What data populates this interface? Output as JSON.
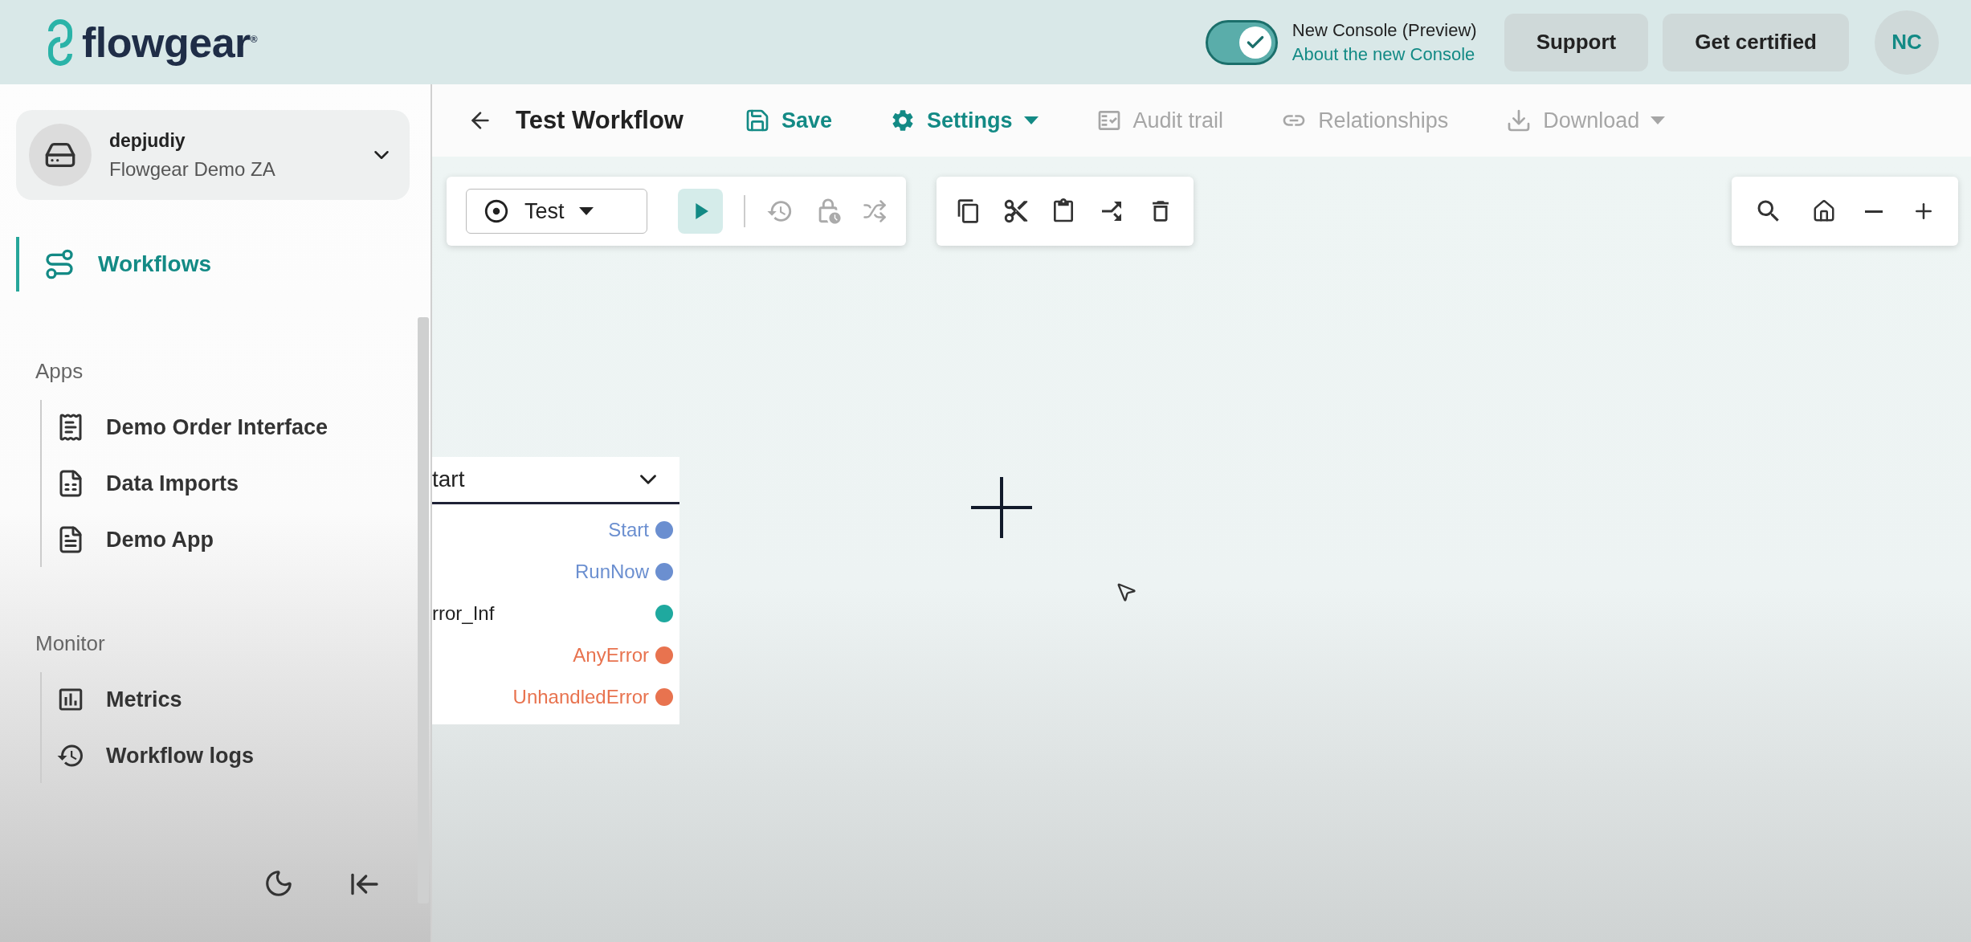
{
  "header": {
    "logo": "flowgear$^{®}$",
    "console_toggle": {
      "on": true,
      "label": "New Console (Preview)",
      "link": "About the new Console"
    },
    "buttons": [
      "Support",
      "Get certified"
    ],
    "avatar": "NC"
  },
  "sidebar": {
    "account": {
      "name": "depjudiy",
      "org": "Flowgear Demo ZA"
    },
    "nav": [
      {
        "label": "Workflows",
        "selected": true
      }
    ],
    "sections": [
      {
        "title": "Apps",
        "items": [
          {
            "label": "Demo Order Interface",
            "kind": "receipt"
          },
          {
            "label": "Data Imports",
            "kind": "sheet"
          },
          {
            "label": "Demo App",
            "kind": "doc"
          }
        ]
      },
      {
        "title": "Monitor",
        "items": [
          {
            "label": "Metrics",
            "kind": "chart"
          },
          {
            "label": "Workflow logs",
            "kind": "history"
          }
        ]
      }
    ]
  },
  "workflow_bar": {
    "title": "Test Workflow",
    "actions": [
      {
        "label": "Save",
        "kind": "save",
        "disabled": false,
        "menu": false
      },
      {
        "label": "Settings",
        "kind": "settings",
        "disabled": false,
        "menu": true
      },
      {
        "label": "Audit trail",
        "kind": "audit",
        "disabled": true,
        "menu": false
      },
      {
        "label": "Relationships",
        "kind": "link",
        "disabled": true,
        "menu": false
      },
      {
        "label": "Download",
        "kind": "download",
        "disabled": true,
        "menu": true
      }
    ]
  },
  "canvas": {
    "run_mode": "Test",
    "node": {
      "title": "tart",
      "ports": [
        {
          "label": "Start",
          "kind": "event",
          "color": "#6b8fd0"
        },
        {
          "label": "RunNow",
          "kind": "event",
          "color": "#6b8fd0"
        },
        {
          "label": "rror_Inf",
          "kind": "value",
          "color": "#1fa99f"
        },
        {
          "label": "AnyError",
          "kind": "event",
          "color": "#e8734f"
        },
        {
          "label": "UnhandledError",
          "kind": "event",
          "color": "#e8734f"
        }
      ]
    }
  }
}
